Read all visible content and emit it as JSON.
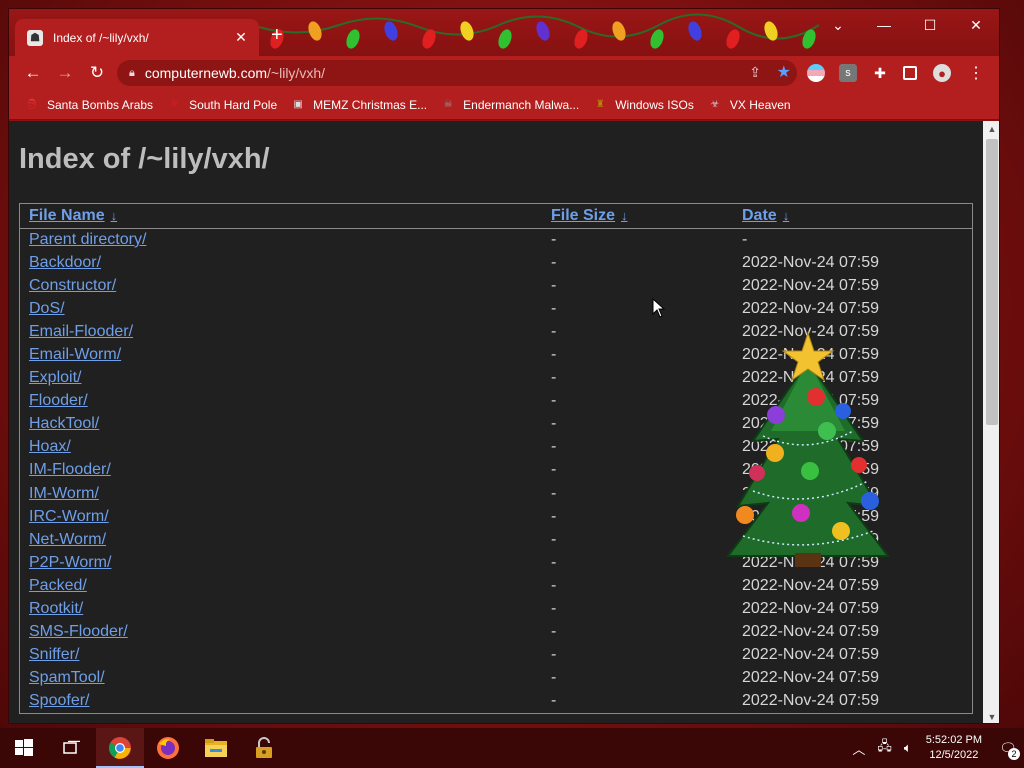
{
  "tab": {
    "title": "Index of /~lily/vxh/",
    "close_glyph": "✕",
    "new_tab_glyph": "+"
  },
  "window_controls": {
    "tab_search": "⌄",
    "minimize": "—",
    "maximize": "☐",
    "close": "✕"
  },
  "toolbar": {
    "back": "←",
    "forward": "→",
    "reload": "↻",
    "url_host": "computernewb.com",
    "url_path": "/~lily/vxh/"
  },
  "bookmarks": [
    {
      "label": "Santa Bombs Arabs",
      "icon": "santa-icon",
      "color": "#d33"
    },
    {
      "label": "South Hard Pole",
      "icon": "snowflake-icon",
      "color": "#c22"
    },
    {
      "label": "MEMZ Christmas E...",
      "icon": "memz-icon",
      "color": "#ddd"
    },
    {
      "label": "Endermanch Malwa...",
      "icon": "skull-icon",
      "color": "#999"
    },
    {
      "label": "Windows ISOs",
      "icon": "bottle-icon",
      "color": "#b8860b"
    },
    {
      "label": "VX Heaven",
      "icon": "vx-icon",
      "color": "#ccc"
    }
  ],
  "page": {
    "heading": "Index of /~lily/vxh/",
    "columns": {
      "name": "File Name",
      "size": "File Size",
      "date": "Date",
      "sort_arrow": "↓"
    },
    "rows": [
      {
        "name": "Parent directory/",
        "size": "-",
        "date": "-"
      },
      {
        "name": "Backdoor/",
        "size": "-",
        "date": "2022-Nov-24 07:59"
      },
      {
        "name": "Constructor/",
        "size": "-",
        "date": "2022-Nov-24 07:59"
      },
      {
        "name": "DoS/",
        "size": "-",
        "date": "2022-Nov-24 07:59"
      },
      {
        "name": "Email-Flooder/",
        "size": "-",
        "date": "2022-Nov-24 07:59"
      },
      {
        "name": "Email-Worm/",
        "size": "-",
        "date": "2022-Nov-24 07:59"
      },
      {
        "name": "Exploit/",
        "size": "-",
        "date": "2022-Nov-24 07:59"
      },
      {
        "name": "Flooder/",
        "size": "-",
        "date": "2022-Nov-24 07:59"
      },
      {
        "name": "HackTool/",
        "size": "-",
        "date": "2022-Nov-24 07:59"
      },
      {
        "name": "Hoax/",
        "size": "-",
        "date": "2022-Nov-24 07:59"
      },
      {
        "name": "IM-Flooder/",
        "size": "-",
        "date": "2022-Nov-24 07:59"
      },
      {
        "name": "IM-Worm/",
        "size": "-",
        "date": "2022-Nov-24 07:59"
      },
      {
        "name": "IRC-Worm/",
        "size": "-",
        "date": "2022-Nov-24 07:59"
      },
      {
        "name": "Net-Worm/",
        "size": "-",
        "date": "2022-Nov-24 07:59"
      },
      {
        "name": "P2P-Worm/",
        "size": "-",
        "date": "2022-Nov-24 07:59"
      },
      {
        "name": "Packed/",
        "size": "-",
        "date": "2022-Nov-24 07:59"
      },
      {
        "name": "Rootkit/",
        "size": "-",
        "date": "2022-Nov-24 07:59"
      },
      {
        "name": "SMS-Flooder/",
        "size": "-",
        "date": "2022-Nov-24 07:59"
      },
      {
        "name": "Sniffer/",
        "size": "-",
        "date": "2022-Nov-24 07:59"
      },
      {
        "name": "SpamTool/",
        "size": "-",
        "date": "2022-Nov-24 07:59"
      },
      {
        "name": "Spoofer/",
        "size": "-",
        "date": "2022-Nov-24 07:59"
      }
    ]
  },
  "taskbar": {
    "apps": [
      "start-icon",
      "task-view-icon",
      "chrome-icon",
      "firefox-icon",
      "file-explorer-icon",
      "lock-app-icon"
    ],
    "clock_time": "5:52:02 PM",
    "clock_date": "12/5/2022",
    "notification_count": "2"
  },
  "colors": {
    "link": "#6f9fe8",
    "page_bg": "#202020",
    "chrome_bg": "#b31e1e",
    "taskbar_bg": "#3a0606"
  }
}
